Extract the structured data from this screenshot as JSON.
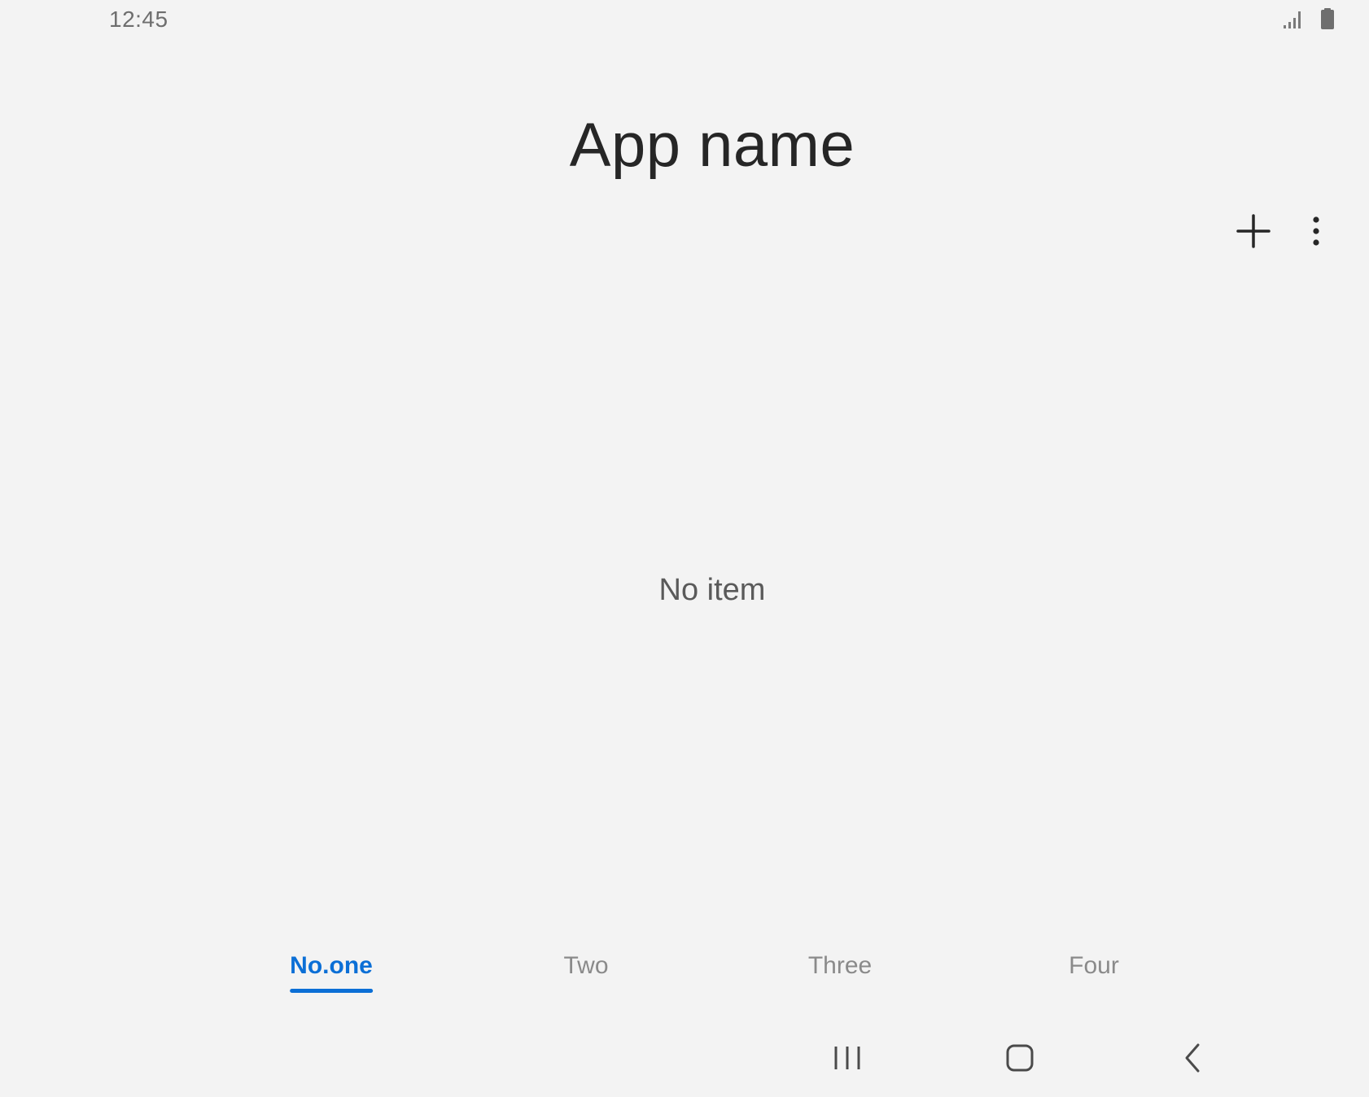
{
  "status_bar": {
    "time": "12:45",
    "icons": [
      "signal-icon",
      "battery-icon"
    ]
  },
  "header": {
    "title": "App name"
  },
  "actions": {
    "items": [
      "add-icon",
      "more-options-icon"
    ]
  },
  "content": {
    "empty_message": "No item"
  },
  "tabs": {
    "items": [
      {
        "label": "No.one",
        "active": true
      },
      {
        "label": "Two",
        "active": false
      },
      {
        "label": "Three",
        "active": false
      },
      {
        "label": "Four",
        "active": false
      }
    ]
  },
  "navigation_bar": {
    "items": [
      "recent-apps-icon",
      "home-icon",
      "back-icon"
    ]
  },
  "colors": {
    "background": "#f3f3f3",
    "accent": "#0b6fd6",
    "title_text": "#262626",
    "inactive_tab": "#8a8a8a"
  }
}
